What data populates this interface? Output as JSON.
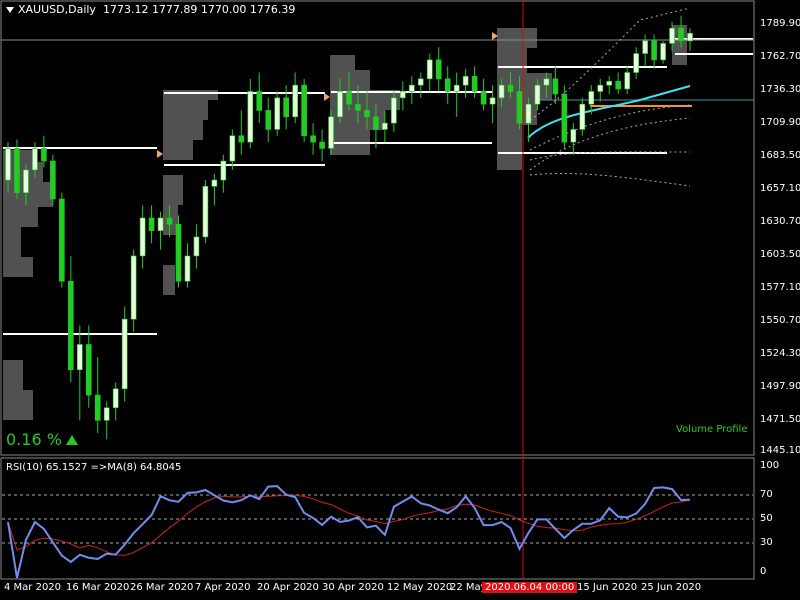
{
  "header": {
    "symbol": "XAUUSD,Daily",
    "ohlc": "1773.12 1777.89 1770.00 1776.39"
  },
  "indicator": {
    "change_pct": "0.16 %",
    "volume_profile_label": "Volume Profile",
    "rsi_label": "RSI(10) 65.1527  =>MA(8) 64.8045"
  },
  "price_axis": [
    "1789.90",
    "1762.70",
    "1736.30",
    "1709.90",
    "1683.50",
    "1657.10",
    "1630.70",
    "1603.50",
    "1577.10",
    "1550.70",
    "1524.30",
    "1497.90",
    "1471.50",
    "1445.10"
  ],
  "rsi_axis": [
    "100",
    "70",
    "50",
    "30",
    "0"
  ],
  "time_axis": [
    "4 Mar 2020",
    "16 Mar 2020",
    "26 Mar 2020",
    "7 Apr 2020",
    "20 Apr 2020",
    "30 Apr 2020",
    "12 May 2020",
    "22 May",
    "15 Jun 2020",
    "25 Jun 2020"
  ],
  "crosshair_time": "2020.06.04 00:00",
  "colors": {
    "bull": "#e8ffe0",
    "bear": "#22cc22",
    "rsi": "#6f8ff0",
    "rsi_ma": "#d22020",
    "crosshair": "#d01010",
    "ma": "#40e0f0",
    "level": "#ff9020"
  },
  "chart_data": {
    "type": "candlestick",
    "candles": [
      [
        1660,
        1690,
        1650,
        1685
      ],
      [
        1685,
        1692,
        1645,
        1650
      ],
      [
        1650,
        1672,
        1640,
        1668
      ],
      [
        1668,
        1690,
        1662,
        1685
      ],
      [
        1685,
        1695,
        1670,
        1675
      ],
      [
        1675,
        1680,
        1640,
        1645
      ],
      [
        1645,
        1650,
        1575,
        1580
      ],
      [
        1580,
        1600,
        1500,
        1510
      ],
      [
        1510,
        1545,
        1470,
        1530
      ],
      [
        1530,
        1545,
        1480,
        1490
      ],
      [
        1490,
        1520,
        1460,
        1470
      ],
      [
        1470,
        1485,
        1455,
        1480
      ],
      [
        1480,
        1500,
        1470,
        1495
      ],
      [
        1495,
        1560,
        1485,
        1550
      ],
      [
        1550,
        1605,
        1540,
        1600
      ],
      [
        1600,
        1640,
        1590,
        1630
      ],
      [
        1630,
        1640,
        1610,
        1620
      ],
      [
        1620,
        1635,
        1605,
        1630
      ],
      [
        1630,
        1640,
        1615,
        1625
      ],
      [
        1625,
        1632,
        1575,
        1580
      ],
      [
        1580,
        1610,
        1575,
        1600
      ],
      [
        1600,
        1625,
        1590,
        1615
      ],
      [
        1615,
        1660,
        1610,
        1655
      ],
      [
        1655,
        1665,
        1640,
        1660
      ],
      [
        1660,
        1680,
        1650,
        1675
      ],
      [
        1675,
        1700,
        1668,
        1695
      ],
      [
        1695,
        1715,
        1680,
        1690
      ],
      [
        1690,
        1740,
        1685,
        1730
      ],
      [
        1730,
        1745,
        1705,
        1715
      ],
      [
        1715,
        1725,
        1690,
        1700
      ],
      [
        1700,
        1730,
        1695,
        1725
      ],
      [
        1725,
        1735,
        1700,
        1710
      ],
      [
        1710,
        1745,
        1705,
        1735
      ],
      [
        1735,
        1740,
        1690,
        1695
      ],
      [
        1695,
        1705,
        1680,
        1690
      ],
      [
        1690,
        1700,
        1675,
        1685
      ],
      [
        1685,
        1715,
        1680,
        1710
      ],
      [
        1710,
        1740,
        1705,
        1730
      ],
      [
        1730,
        1745,
        1715,
        1720
      ],
      [
        1720,
        1735,
        1705,
        1715
      ],
      [
        1715,
        1730,
        1700,
        1710
      ],
      [
        1710,
        1720,
        1685,
        1700
      ],
      [
        1700,
        1715,
        1690,
        1705
      ],
      [
        1705,
        1730,
        1698,
        1725
      ],
      [
        1725,
        1738,
        1715,
        1730
      ],
      [
        1730,
        1742,
        1720,
        1735
      ],
      [
        1735,
        1745,
        1725,
        1740
      ],
      [
        1740,
        1760,
        1730,
        1755
      ],
      [
        1755,
        1765,
        1730,
        1740
      ],
      [
        1740,
        1750,
        1720,
        1730
      ],
      [
        1730,
        1745,
        1710,
        1735
      ],
      [
        1735,
        1748,
        1725,
        1742
      ],
      [
        1742,
        1750,
        1725,
        1730
      ],
      [
        1730,
        1740,
        1715,
        1720
      ],
      [
        1720,
        1735,
        1705,
        1725
      ],
      [
        1725,
        1740,
        1718,
        1735
      ],
      [
        1735,
        1745,
        1725,
        1730
      ],
      [
        1730,
        1742,
        1700,
        1705
      ],
      [
        1705,
        1725,
        1690,
        1720
      ],
      [
        1720,
        1740,
        1715,
        1735
      ],
      [
        1735,
        1745,
        1725,
        1740
      ],
      [
        1740,
        1750,
        1720,
        1728
      ],
      [
        1728,
        1735,
        1685,
        1690
      ],
      [
        1690,
        1705,
        1680,
        1700
      ],
      [
        1700,
        1725,
        1695,
        1720
      ],
      [
        1720,
        1735,
        1712,
        1730
      ],
      [
        1730,
        1740,
        1722,
        1735
      ],
      [
        1735,
        1742,
        1728,
        1738
      ],
      [
        1738,
        1745,
        1728,
        1732
      ],
      [
        1732,
        1750,
        1728,
        1745
      ],
      [
        1745,
        1765,
        1740,
        1760
      ],
      [
        1760,
        1775,
        1750,
        1770
      ],
      [
        1770,
        1775,
        1748,
        1755
      ],
      [
        1755,
        1770,
        1752,
        1768
      ],
      [
        1768,
        1785,
        1762,
        1780
      ],
      [
        1780,
        1790,
        1765,
        1770
      ],
      [
        1770,
        1780,
        1762,
        1776
      ]
    ]
  }
}
